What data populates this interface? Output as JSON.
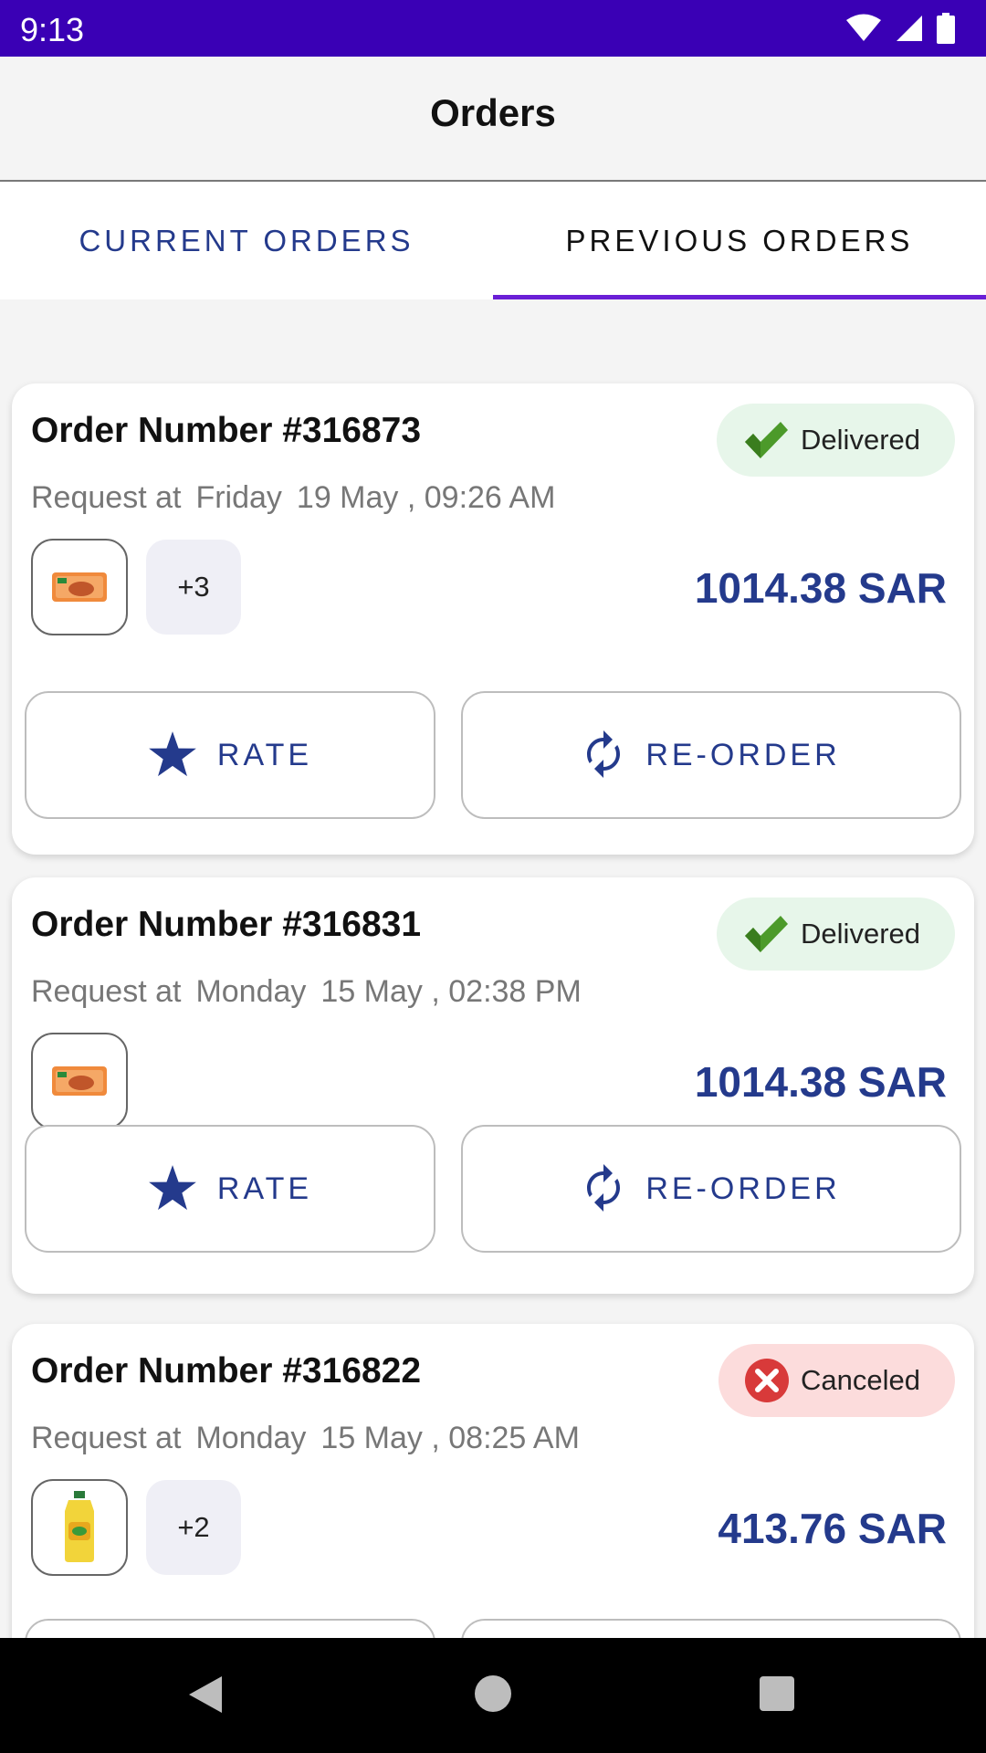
{
  "status_bar": {
    "time": "9:13"
  },
  "app_bar": {
    "title": "Orders"
  },
  "tabs": [
    {
      "label": "CURRENT ORDERS",
      "selected": false
    },
    {
      "label": "PREVIOUS ORDERS",
      "selected": true
    }
  ],
  "colors": {
    "accent": "#243a8c",
    "status_bar": "#3a00b5",
    "tab_indicator": "#6a1fd6",
    "delivered_bg": "#e7f6ea",
    "canceled_bg": "#fcdcdc"
  },
  "orders": [
    {
      "order_number": "Order Number #316873",
      "request_prefix": "Request at",
      "day": "Friday",
      "datetime": "19 May , 09:26 AM",
      "status": "Delivered",
      "status_icon": "check-icon",
      "thumbnail": "noodle-pack-image",
      "more_count": "+3",
      "price": "1014.38 SAR",
      "rate_label": "RATE",
      "reorder_label": "RE-ORDER"
    },
    {
      "order_number": "Order Number #316831",
      "request_prefix": "Request at",
      "day": "Monday",
      "datetime": "15 May , 02:38 PM",
      "status": "Delivered",
      "status_icon": "check-icon",
      "thumbnail": "noodle-pack-image",
      "price": "1014.38 SAR",
      "rate_label": "RATE",
      "reorder_label": "RE-ORDER"
    },
    {
      "order_number": "Order Number #316822",
      "request_prefix": "Request at",
      "day": "Monday",
      "datetime": "15 May , 08:25 AM",
      "status": "Canceled",
      "status_icon": "cancel-icon",
      "thumbnail": "oil-bottle-image",
      "more_count": "+2",
      "price": "413.76 SAR"
    }
  ]
}
